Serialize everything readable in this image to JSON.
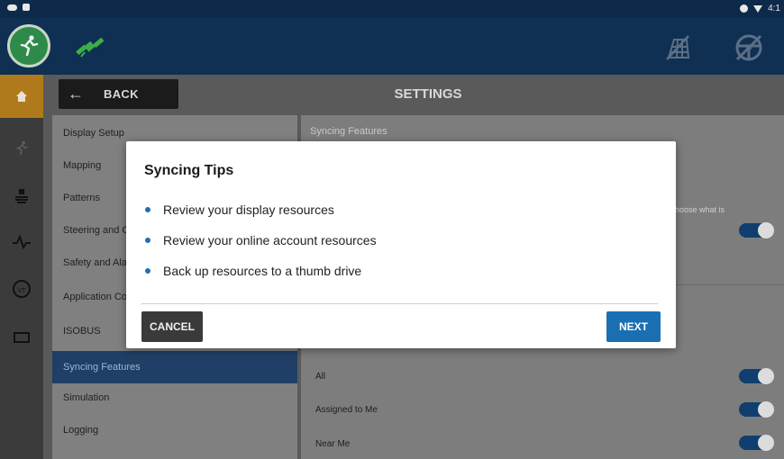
{
  "statusbar": {
    "time": "4:1"
  },
  "header": {
    "icons": [
      "run-icon",
      "satellite-icon",
      "field-icon",
      "steering-wheel-icon"
    ]
  },
  "rail": {
    "items": [
      "home-icon",
      "run-icon",
      "layers-icon",
      "pulse-icon",
      "vt-icon",
      "display-icon"
    ],
    "vt_label": "VT"
  },
  "toolbar": {
    "back_label": "BACK",
    "title": "SETTINGS"
  },
  "menu": {
    "items": [
      {
        "label": "Display Setup"
      },
      {
        "label": "Mapping"
      },
      {
        "label": "Patterns"
      },
      {
        "label": "Steering and G"
      },
      {
        "label": "Safety and Ala"
      },
      {
        "label": "Application Co"
      },
      {
        "label": "ISOBUS"
      },
      {
        "label": "Syncing Features"
      },
      {
        "label": "Simulation"
      },
      {
        "label": "Logging"
      }
    ],
    "active_index": 7
  },
  "content": {
    "section_title": "Syncing Features",
    "peek_text": "hoose what is",
    "rows": [
      {
        "label": "All",
        "on": true
      },
      {
        "label": "Assigned to Me",
        "on": true
      },
      {
        "label": "Near Me",
        "on": true
      }
    ]
  },
  "modal": {
    "title": "Syncing Tips",
    "tips": [
      "Review your display resources",
      "Review your online account resources",
      "Back up resources to a thumb drive"
    ],
    "cancel_label": "CANCEL",
    "next_label": "NEXT"
  },
  "colors": {
    "header": "#0f2f53",
    "accent": "#1a6fb3",
    "home": "#b07a1c",
    "run_green": "#2e8a48",
    "active_menu": "#1f3f66"
  }
}
